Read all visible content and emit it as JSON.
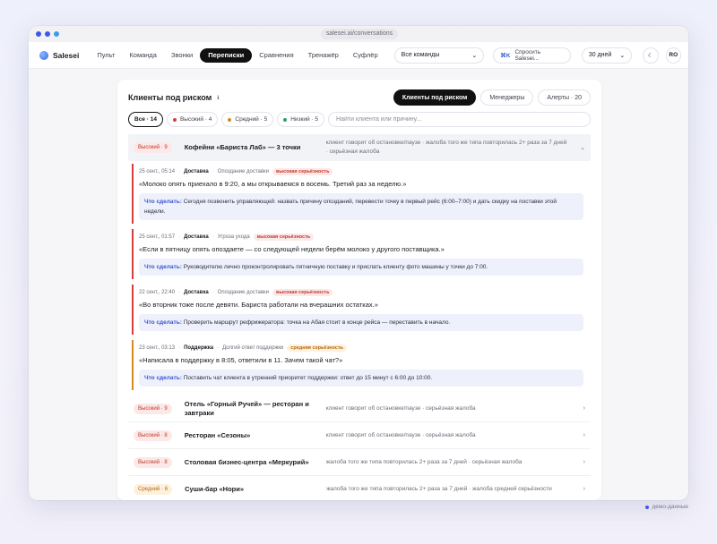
{
  "browser": {
    "url": "salesei.ai/conversations",
    "dot_colors": [
      "#3b5ae8",
      "#3b5ae8",
      "#3b9ee8"
    ]
  },
  "brand": "Salesei",
  "nav": [
    {
      "label": "Пульт"
    },
    {
      "label": "Команда"
    },
    {
      "label": "Звонки"
    },
    {
      "label": "Переписки",
      "active": true
    },
    {
      "label": "Сравнения"
    },
    {
      "label": "Тренажёр"
    },
    {
      "label": "Суфлёр"
    }
  ],
  "team_select": {
    "value": "Все команды"
  },
  "ask": {
    "shortcut": "⌘K",
    "label": "Спросить Salesei..."
  },
  "period_select": {
    "value": "30 дней"
  },
  "theme_icon": "moon-icon",
  "avatar": "RO",
  "panel": {
    "title": "Клиенты под риском",
    "tabs": [
      {
        "label": "Клиенты под риском",
        "active": true
      },
      {
        "label": "Менеджеры"
      },
      {
        "label": "Алерты · 20"
      }
    ],
    "filters": [
      {
        "label": "Все · 14",
        "active": true
      },
      {
        "label": "Высокий · 4",
        "dot": "#d63d3d"
      },
      {
        "label": "Средний · 5",
        "dot": "#d88a1e"
      },
      {
        "label": "Низкий · 5",
        "dot": "#2e9d6a"
      }
    ],
    "search_placeholder": "Найти клиента или причину..."
  },
  "expanded_client": {
    "badge": "Высокий · 9",
    "name": "Кофейни «Бариста Лаб» — 3 точки",
    "reason": "клиент говорит об остановке/паузе · жалоба того же типа повторилась 2+ раза за 7 дней · серьёзная жалоба",
    "items": [
      {
        "date": "25 сент., 05:14",
        "channel": "Доставка",
        "topic": "Опоздание доставки",
        "sev": "высокая серьёзность",
        "level": "high",
        "quote": "«Молоко опять приехало в 9:20, а мы открываемся в восемь. Третий раз за неделю.»",
        "todo_label": "Что сделать:",
        "todo": "Сегодня позвонить управляющей: назвать причину опозданий, перевести точку в первый рейс (6:00–7:00) и дать скидку на поставки этой недели."
      },
      {
        "date": "25 сент., 01:57",
        "channel": "Доставка",
        "topic": "Угроза ухода",
        "sev": "высокая серьёзность",
        "level": "high",
        "quote": "«Если в пятницу опять опоздаете — со следующей недели берём молоко у другого поставщика.»",
        "todo_label": "Что сделать:",
        "todo": "Руководителю лично проконтролировать пятничную поставку и прислать клиенту фото машины у точки до 7:00."
      },
      {
        "date": "22 сент., 22:40",
        "channel": "Доставка",
        "topic": "Опоздание доставки",
        "sev": "высокая серьёзность",
        "level": "high",
        "quote": "«Во вторник тоже после девяти. Бариста работали на вчерашних остатках.»",
        "todo_label": "Что сделать:",
        "todo": "Проверить маршрут рефрижератора: точка на Абая стоит в конце рейса — переставить в начало."
      },
      {
        "date": "23 сент., 03:13",
        "channel": "Поддержка",
        "topic": "Долгий ответ поддержки",
        "sev": "средняя серьёзность",
        "level": "mid",
        "quote": "«Написала в поддержку в 8:05, ответили в 11. Зачем такой чат?»",
        "todo_label": "Что сделать:",
        "todo": "Поставить чат клиента в утренний приоритет поддержки: ответ до 15 минут с 6:00 до 10:00."
      }
    ]
  },
  "clients": [
    {
      "badge": "Высокий · 9",
      "level": "high",
      "name": "Отель «Горный Ручей» — ресторан и завтраки",
      "reason": "клиент говорит об остановке/паузе · серьёзная жалоба"
    },
    {
      "badge": "Высокий · 8",
      "level": "high",
      "name": "Ресторан «Сезоны»",
      "reason": "клиент говорит об остановке/паузе · серьёзная жалоба"
    },
    {
      "badge": "Высокий · 8",
      "level": "high",
      "name": "Столовая бизнес-центра «Меркурий»",
      "reason": "жалоба того же типа повторилась 2+ раза за 7 дней · серьёзная жалоба"
    },
    {
      "badge": "Средний · 6",
      "level": "mid",
      "name": "Суши-бар «Нори»",
      "reason": "жалоба того же типа повторилась 2+ раза за 7 дней · жалоба средней серьёзности"
    }
  ],
  "footer_note": "демо-данные",
  "colors": {
    "high": "#d63d3d",
    "mid": "#d88a1e",
    "accent": "#3a56c9"
  }
}
